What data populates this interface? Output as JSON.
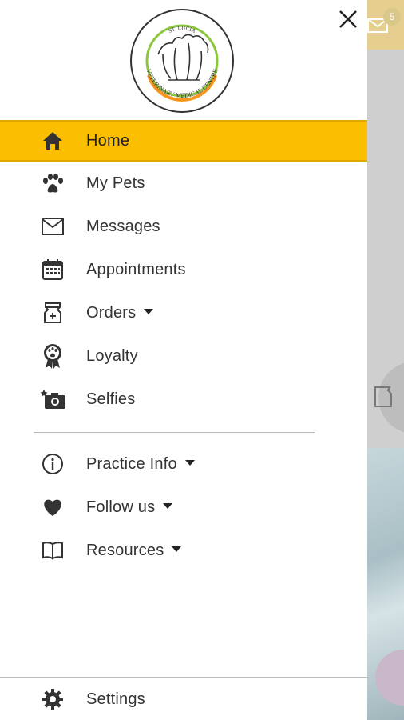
{
  "background_app": {
    "badge_count": "5"
  },
  "drawer": {
    "logo_text": {
      "top": "ST. LUCIA",
      "ring": "VETERINARY MEDICAL CENTRE"
    },
    "primary_items": [
      {
        "label": "Home",
        "icon": "home-icon",
        "active": true
      },
      {
        "label": "My Pets",
        "icon": "paw-icon"
      },
      {
        "label": "Messages",
        "icon": "mail-icon"
      },
      {
        "label": "Appointments",
        "icon": "calendar-icon"
      },
      {
        "label": "Orders",
        "icon": "food-bag-icon",
        "has_dropdown": true
      },
      {
        "label": "Loyalty",
        "icon": "award-ribbon-icon"
      },
      {
        "label": "Selfies",
        "icon": "camera-icon"
      }
    ],
    "secondary_items": [
      {
        "label": "Practice Info",
        "icon": "info-icon",
        "has_dropdown": true
      },
      {
        "label": "Follow us",
        "icon": "heart-icon",
        "has_dropdown": true
      },
      {
        "label": "Resources",
        "icon": "book-icon",
        "has_dropdown": true
      }
    ],
    "footer_item": {
      "label": "Settings",
      "icon": "gear-icon"
    }
  },
  "colors": {
    "active_bg": "#fbbe00",
    "logo_green": "#8cc63f",
    "logo_orange": "#f7941d"
  }
}
